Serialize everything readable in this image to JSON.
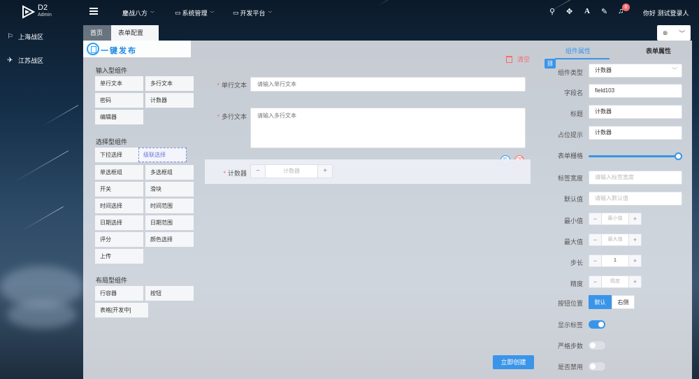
{
  "header": {
    "logo_title": "D2",
    "logo_sub": "Admin",
    "nav": [
      {
        "label": "鏖战八方"
      },
      {
        "label": "系统管理"
      },
      {
        "label": "开发平台"
      }
    ],
    "notification_count": "6",
    "user_greeting": "你好 测试登录人"
  },
  "sidebar": {
    "items": [
      {
        "label": "上海战区"
      },
      {
        "label": "江苏战区"
      }
    ]
  },
  "tabs": {
    "home": "首页",
    "active": "表单配置"
  },
  "left_panel": {
    "brand": "一键发布",
    "groups": [
      {
        "title": "输入型组件",
        "items": [
          "单行文本",
          "多行文本",
          "密码",
          "计数器",
          "编辑器"
        ]
      },
      {
        "title": "选择型组件",
        "items": [
          "下拉选择",
          "级联选择",
          "单选框组",
          "多选框组",
          "开关",
          "滑块",
          "时间选择",
          "时间范围",
          "日期选择",
          "日期范围",
          "评分",
          "颜色选择",
          "上传"
        ]
      },
      {
        "title": "布局型组件",
        "items": [
          "行容器",
          "按钮",
          "表格[开发中]"
        ]
      }
    ]
  },
  "canvas": {
    "clear_label": "清空",
    "fields": [
      {
        "label": "单行文本",
        "placeholder": "请输入单行文本"
      },
      {
        "label": "多行文本",
        "placeholder": "请输入多行文本"
      },
      {
        "label": "计数器",
        "placeholder": "计数器",
        "minus": "−",
        "plus": "+"
      }
    ],
    "submit_label": "立即创建"
  },
  "right_panel": {
    "tab_component": "组件属性",
    "tab_form": "表单属性",
    "rows": {
      "type": {
        "label": "组件类型",
        "value": "计数器"
      },
      "field_name": {
        "label": "字段名",
        "value": "field103"
      },
      "title": {
        "label": "标题",
        "value": "计数器"
      },
      "placeholder": {
        "label": "占位提示",
        "value": "计数器"
      },
      "grid": {
        "label": "表单栅格",
        "value": 1.0
      },
      "label_width": {
        "label": "标签宽度",
        "placeholder": "请输入标签宽度"
      },
      "default": {
        "label": "默认值",
        "placeholder": "请输入默认值"
      },
      "min": {
        "label": "最小值",
        "placeholder": "最小值"
      },
      "max": {
        "label": "最大值",
        "placeholder": "最大值"
      },
      "step": {
        "label": "步长",
        "value": "1"
      },
      "precision": {
        "label": "精度",
        "placeholder": "精度"
      },
      "button_position": {
        "label": "按钮位置",
        "options": [
          "默认",
          "右侧"
        ],
        "selected": "默认"
      },
      "show_label": {
        "label": "显示标签",
        "on": true
      },
      "strict_step": {
        "label": "严格步数",
        "on": false
      },
      "disabled": {
        "label": "是否禁用",
        "on": false
      }
    }
  },
  "colors": {
    "accent": "#3a95e8",
    "danger": "#f56c6c"
  }
}
